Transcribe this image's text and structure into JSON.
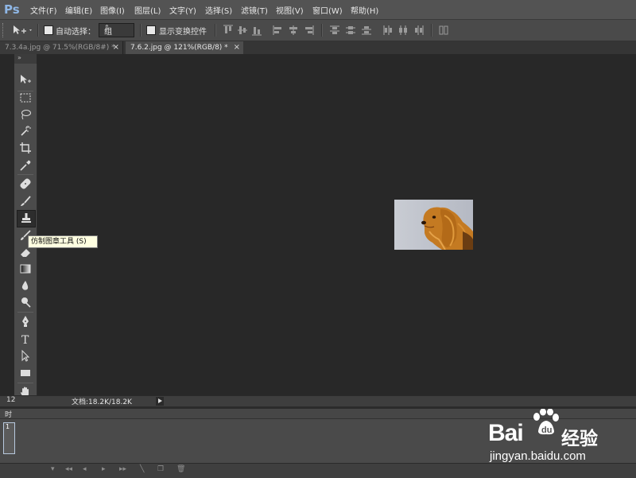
{
  "app": {
    "logo": "Ps"
  },
  "menu": [
    "文件(F)",
    "编辑(E)",
    "图像(I)",
    "图层(L)",
    "文字(Y)",
    "选择(S)",
    "滤镜(T)",
    "视图(V)",
    "窗口(W)",
    "帮助(H)"
  ],
  "options": {
    "auto_select_label": "自动选择：",
    "auto_select_value": "组",
    "show_transform_label": "显示变换控件"
  },
  "tabs": [
    {
      "label": "7.3.4a.jpg @ 71.5%(RGB/8#) *",
      "active": false
    },
    {
      "label": "7.6.2.jpg @ 121%(RGB/8) *",
      "active": true
    }
  ],
  "toolbar": {
    "collapse_glyph": "»",
    "active_tool": "clone-stamp-tool"
  },
  "tooltip": "仿制图章工具 (S)",
  "status": {
    "zoom": "12",
    "doc_info": "文档:18.2K/18.2K"
  },
  "timeline": {
    "title": "时",
    "frame_number": "1"
  },
  "colors": {
    "foreground": "#2a19ff",
    "background": "#c8e21a",
    "tooltip_bg": "#ffffe1",
    "canvas_bg": "#282828"
  },
  "watermark": {
    "brand": "Bai",
    "brand2": "du",
    "cn": "经验",
    "url": "jingyan.baidu.com"
  }
}
